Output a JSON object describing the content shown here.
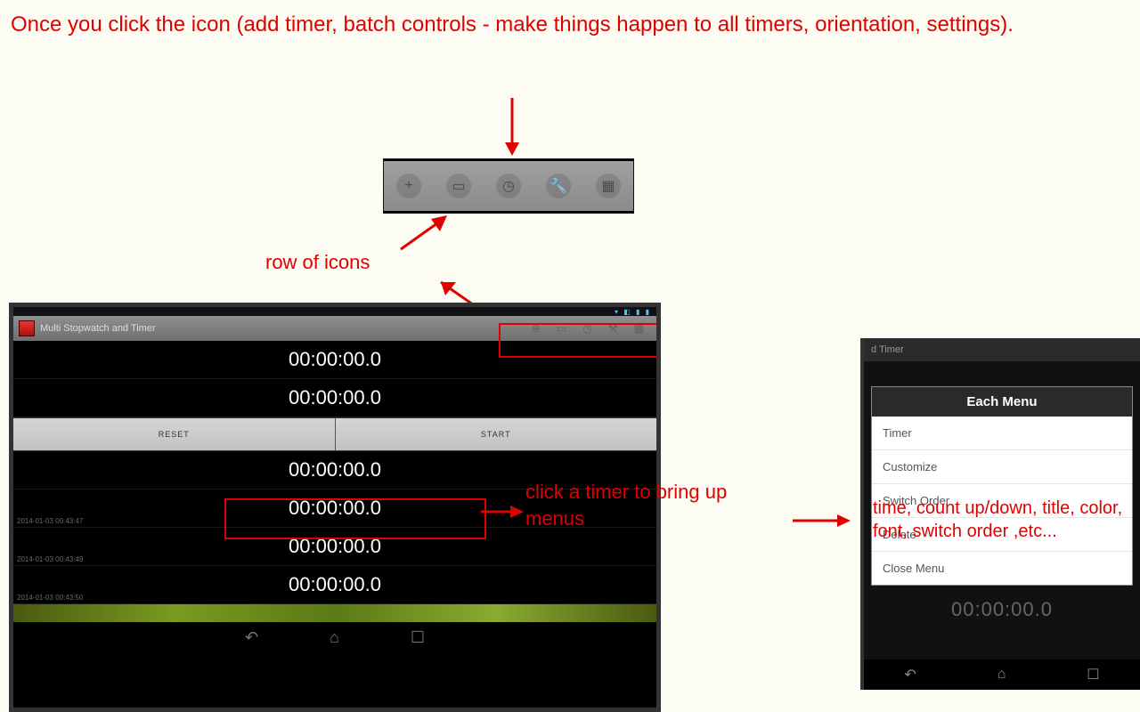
{
  "annotations": {
    "top": "Once you click the icon (add timer, batch controls - make things happen to all timers,  orientation, settings).",
    "row_of_icons": "row of icons",
    "click_timer": "click a timer to bring up menus",
    "menu_desc": "time, count up/down, title, color, font, switch order ,etc..."
  },
  "iconbar": {
    "icons": [
      "plus-icon",
      "monitor-icon",
      "clock-icon",
      "wrench-icon",
      "app-icon"
    ]
  },
  "tablet": {
    "app_title": "Multi Stopwatch and Timer",
    "buttons": {
      "reset": "RESET",
      "start": "START"
    },
    "timers": [
      "00:00:00.0",
      "00:00:00.0",
      "00:00:00.0",
      "00:00:00.0",
      "00:00:00.0",
      "00:00:00.0"
    ],
    "timestamps": [
      "2014-01-03 00:43:47",
      "2014-01-03 00:43:49",
      "2014-01-03 00:43:50"
    ]
  },
  "phone": {
    "app_title": "d Timer",
    "menu_title": "Each Menu",
    "menu_items": [
      "Timer",
      "Customize",
      "Switch Order",
      "Delete",
      "Close Menu"
    ],
    "bg_timer": "00:00:00.0"
  }
}
